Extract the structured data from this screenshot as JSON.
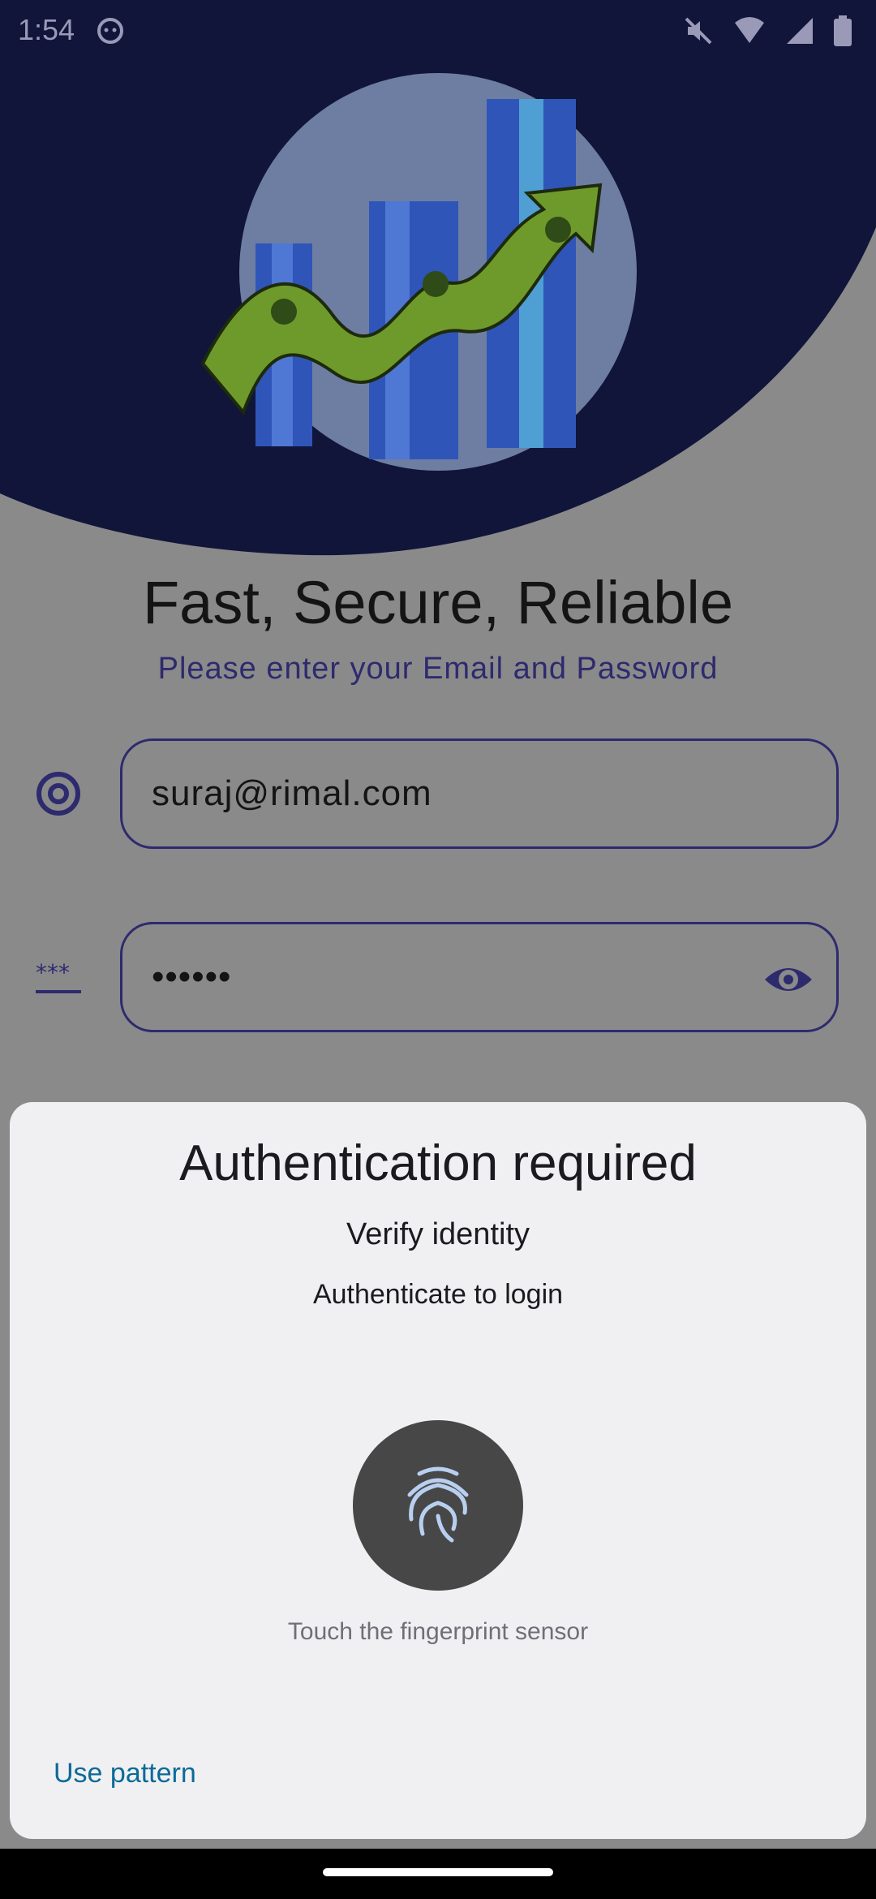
{
  "status_bar": {
    "time": "1:54",
    "icons": [
      "cat-notification-icon",
      "mute-icon",
      "wifi-icon",
      "signal-icon",
      "battery-icon"
    ]
  },
  "app": {
    "headline": "Fast, Secure, Reliable",
    "subline": "Please enter your Email and Password",
    "email": {
      "value": "suraj@rimal.com",
      "icon": "at-icon"
    },
    "password": {
      "value": "••••••",
      "icon": "password-icon",
      "toggle_icon": "eye-icon"
    },
    "colors": {
      "header_navy": "#11153a",
      "accent": "#2e2a6e",
      "money_green": "#6e9a2c",
      "bar_blue": "#2f55b8"
    }
  },
  "dialog": {
    "title": "Authentication required",
    "subtitle": "Verify identity",
    "description": "Authenticate to login",
    "fingerprint_hint": "Touch the fingerprint sensor",
    "alternate_button": "Use pattern",
    "colors": {
      "sheet": "#f0f0f3",
      "link": "#0b6a97",
      "fingerprint_bg": "#474747",
      "fingerprint_stroke": "#b9cff0"
    }
  }
}
